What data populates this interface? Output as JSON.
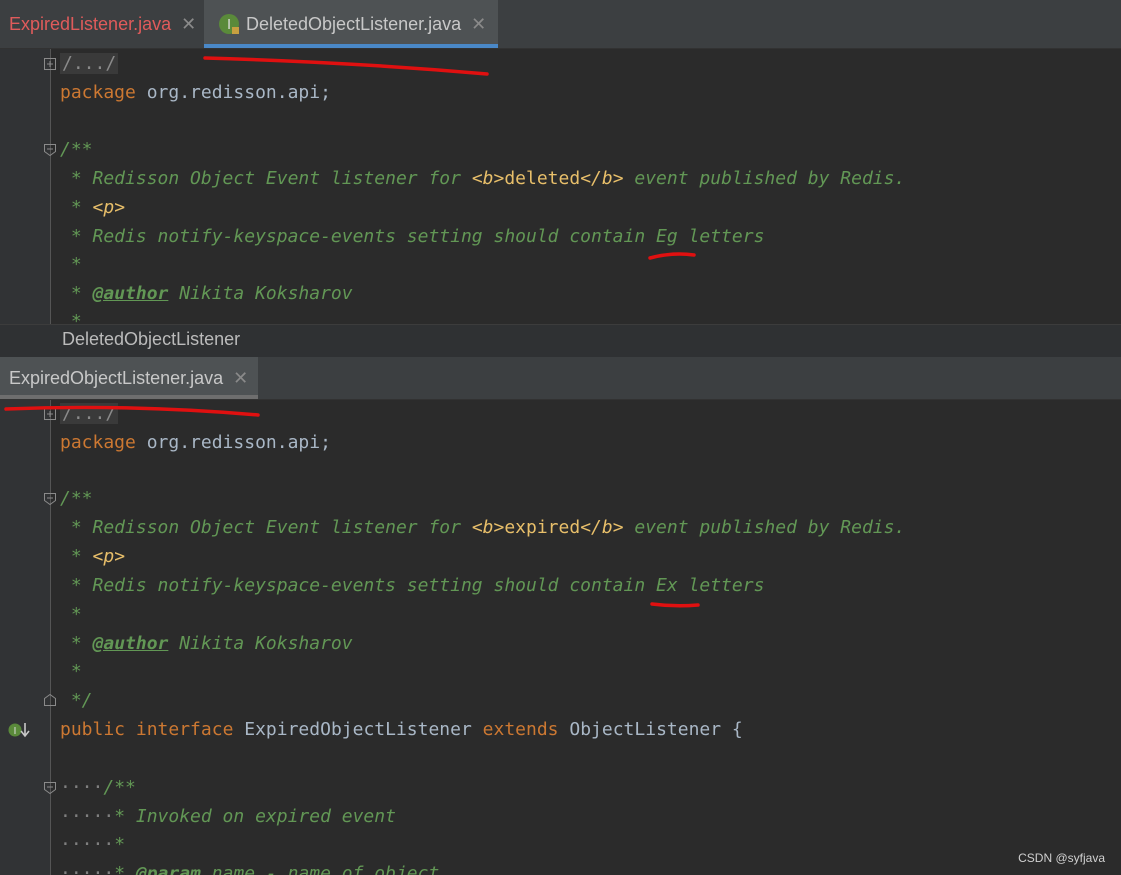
{
  "top_tabs": [
    {
      "label": "ExpiredListener.java",
      "color": "#e05b5b",
      "active": false
    },
    {
      "label": "DeletedObjectListener.java",
      "color": "#bbbbbb",
      "active": true
    }
  ],
  "top_editor": {
    "fold_label": "/.../",
    "package_kw": "package",
    "package_name": " org.redisson.api;",
    "doc_open": "/**",
    "doc1_prefix": " * Redisson Object Event listener for ",
    "doc1_tag1": "<b>",
    "doc1_word": "deleted",
    "doc1_tag2": "</b>",
    "doc1_suffix": " event published by Redis.",
    "doc2_prefix": " * ",
    "doc2_tag": "<p>",
    "doc3": " * Redis notify-keyspace-events setting should contain Eg letters",
    "doc4": " *",
    "doc5_prefix": " * ",
    "doc5_ann": "@author",
    "doc5_suffix": " Nikita Koksharov",
    "doc6": " *"
  },
  "breadcrumb": "DeletedObjectListener",
  "bottom_tab": {
    "label": "ExpiredObjectListener.java",
    "active": true
  },
  "bottom_editor": {
    "fold_label": "/.../",
    "package_kw": "package",
    "package_name": " org.redisson.api;",
    "doc_open": "/**",
    "doc1_prefix": " * Redisson Object Event listener for ",
    "doc1_tag1": "<b>",
    "doc1_word": "expired",
    "doc1_tag2": "</b>",
    "doc1_suffix": " event published by Redis.",
    "doc2_prefix": " * ",
    "doc2_tag": "<p>",
    "doc3": " * Redis notify-keyspace-events setting should contain Ex letters",
    "doc4": " *",
    "doc5_prefix": " * ",
    "doc5_ann": "@author",
    "doc5_suffix": " Nikita Koksharov",
    "doc6": " *",
    "doc_close": " */",
    "decl_public": "public",
    "decl_interface": " interface",
    "decl_name": " ExpiredObjectListener",
    "decl_extends": " extends",
    "decl_parent": " ObjectListener {",
    "inner_doc_open": "/**",
    "inner_doc1": "* Invoked on expired event",
    "inner_doc2": "*",
    "inner_doc3_prefix": "* ",
    "inner_doc3_ann": "@param",
    "inner_doc3_suffix": " name - name of object",
    "indent_dots": "····",
    "indent_dots5": "·····"
  },
  "watermark": "CSDN @syfjava"
}
